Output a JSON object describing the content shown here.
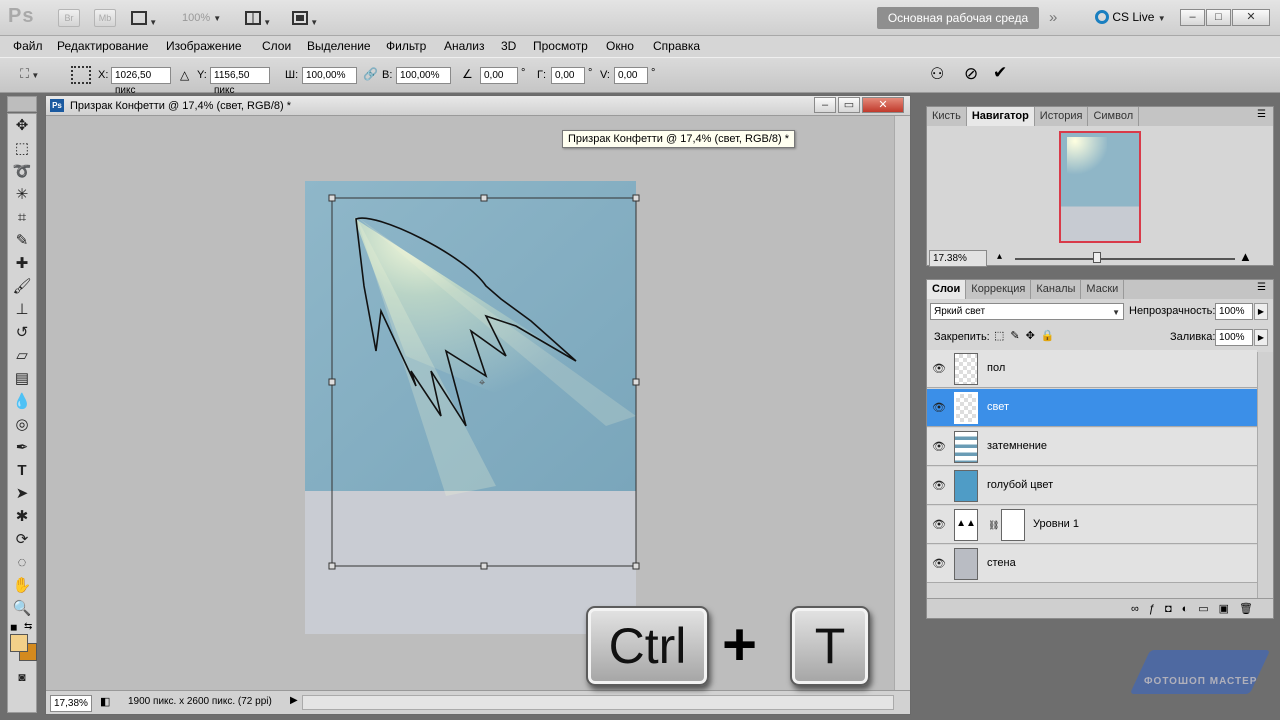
{
  "app": {
    "logo": "Ps",
    "bridge": "Br",
    "minibridge": "Mb",
    "zoom": "100%",
    "workspace": "Основная рабочая среда",
    "cslive": "CS Live"
  },
  "menu": [
    "Файл",
    "Редактирование",
    "Изображение",
    "Слои",
    "Выделение",
    "Фильтр",
    "Анализ",
    "3D",
    "Просмотр",
    "Окно",
    "Справка"
  ],
  "options": {
    "x_label": "X:",
    "x_value": "1026,50 пикс",
    "y_label": "Y:",
    "y_value": "1156,50 пикс",
    "w_label": "Ш:",
    "w_value": "100,00%",
    "h_label": "В:",
    "h_value": "100,00%",
    "angle_value": "0,00",
    "angle_unit": "°",
    "hskew_label": "Г:",
    "hskew_value": "0,00",
    "vskew_label": "V:",
    "vskew_value": "0,00"
  },
  "document": {
    "title": "Призрак Конфетти @ 17,4% (свет, RGB/8) *",
    "tooltip": "Призрак Конфетти @ 17,4% (свет, RGB/8) *",
    "zoom": "17,38%",
    "info": "1900 пикс. x 2600 пикс. (72 ppi)"
  },
  "navigator": {
    "tabs": [
      "Кисть",
      "Навигатор",
      "История",
      "Символ"
    ],
    "active_tab": 1,
    "zoom": "17.38%"
  },
  "layers_panel": {
    "tabs": [
      "Слои",
      "Коррекция",
      "Каналы",
      "Маски"
    ],
    "active_tab": 0,
    "blend_mode": "Яркий свет",
    "opacity_label": "Непрозрачность:",
    "opacity_value": "100%",
    "lock_label": "Закрепить:",
    "fill_label": "Заливка:",
    "fill_value": "100%",
    "layers": [
      {
        "name": "пол",
        "thumb": "transparent",
        "selected": false
      },
      {
        "name": "свет",
        "thumb": "transparent",
        "selected": true
      },
      {
        "name": "затемнение",
        "thumb": "gradient",
        "selected": false
      },
      {
        "name": "голубой цвет",
        "thumb": "blue",
        "selected": false
      },
      {
        "name": "Уровни 1",
        "thumb": "levels",
        "selected": false
      },
      {
        "name": "стена",
        "thumb": "gray",
        "selected": false
      }
    ]
  },
  "overlay": {
    "key1": "Ctrl",
    "plus": "+",
    "key2": "T",
    "watermark": "ФОТОШОП МАСТЕР"
  },
  "colors": {
    "selection": "#3b8fe8",
    "foreground": "#f3d089",
    "background": "#d48a1e",
    "sky": "#86b0c4",
    "floor": "#c9ccd3"
  }
}
